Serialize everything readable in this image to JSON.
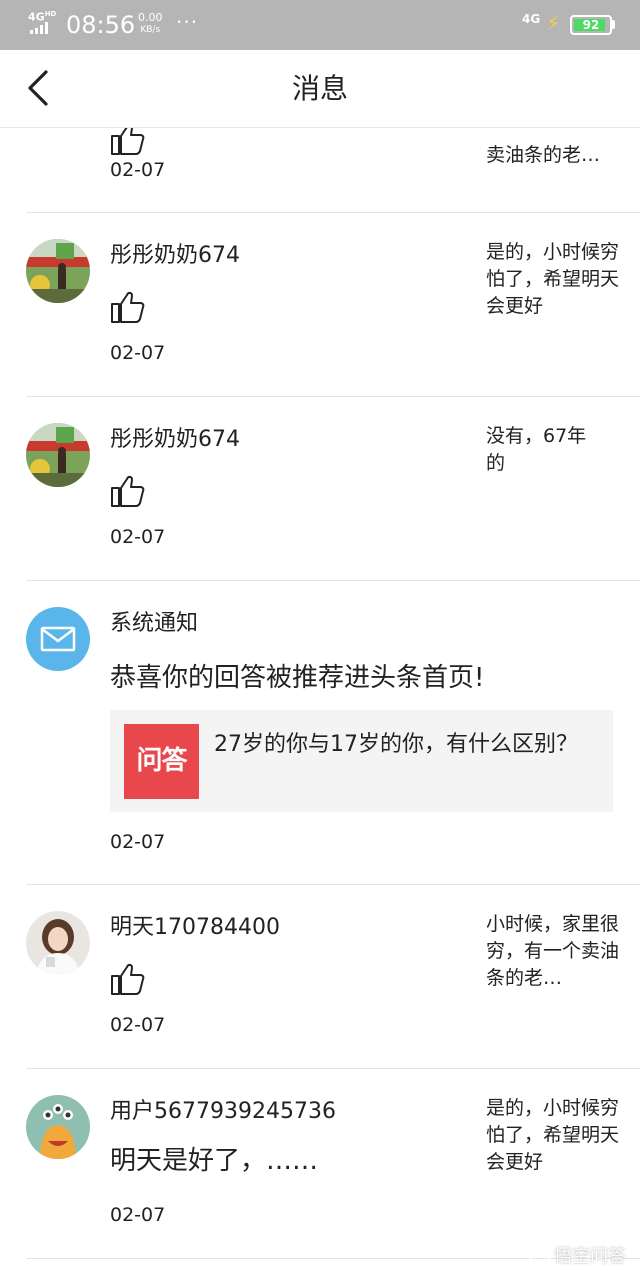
{
  "status_bar": {
    "network": "4G",
    "network_sup": "HD",
    "time": "08:56",
    "speed_value": "0.00",
    "speed_unit": "KB/s",
    "dots": "···",
    "cell": "4G",
    "battery": "92",
    "battery_level": 0.92,
    "battery_color": "#4cd964"
  },
  "header": {
    "title": "消息",
    "back_icon": "chevron-left-icon"
  },
  "items": [
    {
      "snippet": "卖油条的老…",
      "date": "02-07",
      "icon": "thumbs-up-icon"
    },
    {
      "name": "彤彤奶奶674",
      "snippet": "是的，小时候穷怕了，希望明天会更好",
      "date": "02-07",
      "icon": "thumbs-up-icon"
    },
    {
      "name": "彤彤奶奶674",
      "snippet": "没有，67年的",
      "date": "02-07",
      "icon": "thumbs-up-icon"
    },
    {
      "name": "系统通知",
      "title": "恭喜你的回答被推荐进头条首页!",
      "card_logo": "问答",
      "card_text": "27岁的你与17岁的你，有什么区别？",
      "date": "02-07",
      "icon": "mail-icon",
      "icon_color": "#59b5ea"
    },
    {
      "name": "明天170784400",
      "snippet": "小时候，家里很穷，有一个卖油条的老…",
      "date": "02-07",
      "icon": "thumbs-up-icon"
    },
    {
      "name": "用户5677939245736",
      "comment": "明天是好了，……",
      "snippet": "是的，小时候穷怕了，希望明天会更好",
      "date": "02-07"
    }
  ],
  "watermark": "悟空问答",
  "colors": {
    "status_bar": "#b5b5b5",
    "accent_red": "#e8484c",
    "mail_blue": "#59b5ea"
  }
}
